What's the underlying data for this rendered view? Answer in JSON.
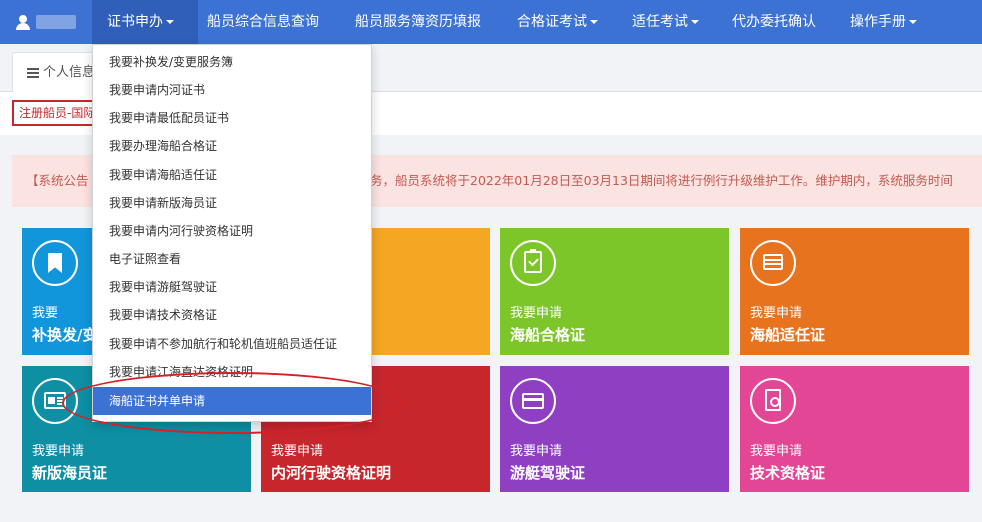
{
  "navbar": {
    "items": [
      {
        "label": "证书申办",
        "caret": true
      },
      {
        "label": "船员综合信息查询",
        "caret": false
      },
      {
        "label": "船员服务簿资历填报",
        "caret": false
      },
      {
        "label": "合格证考试",
        "caret": true
      },
      {
        "label": "适任考试",
        "caret": true
      },
      {
        "label": "代办委托确认",
        "caret": false
      },
      {
        "label": "操作手册",
        "caret": true
      }
    ]
  },
  "tab": {
    "label": "个人信息"
  },
  "status_box": {
    "text": "注册船员-国际"
  },
  "announcement": {
    "left": "【系统公告",
    "right": "务，船员系统将于2022年01月28日至03月13日期间将进行例行升级维护工作。维护期内，系统服务时间"
  },
  "dropdown": {
    "items": [
      "我要补换发/变更服务簿",
      "我要申请内河证书",
      "我要申请最低配员证书",
      "我要办理海船合格证",
      "我要申请海船适任证",
      "我要申请新版海员证",
      "我要申请内河行驶资格证明",
      "电子证照查看",
      "我要申请游艇驾驶证",
      "我要申请技术资格证",
      "我要申请不参加航行和轮机值班船员适任证",
      "我要申请江海直达资格证明",
      "海船证书并单申请"
    ],
    "selected_index": 12
  },
  "tiles": {
    "t1": {
      "line1": "我要",
      "line2": "补换发/变",
      "color": "#1296db",
      "icon": "bookmark-icon"
    },
    "t2": {
      "color": "#f5a623"
    },
    "t3": {
      "line1": "我要申请",
      "line2": "海船合格证",
      "color": "#7cc629",
      "icon": "clipboard-check-icon"
    },
    "t4": {
      "line1": "我要申请",
      "line2": "海船适任证",
      "color": "#e8731f",
      "icon": "list-icon"
    },
    "t5": {
      "line1": "我要申请",
      "line2": "新版海员证",
      "color": "#0e8fa3",
      "icon": "newspaper-icon"
    },
    "t6": {
      "line1": "我要申请",
      "line2": "内河行驶资格证明",
      "color": "#c7262d"
    },
    "t7": {
      "line1": "我要申请",
      "line2": "游艇驾驶证",
      "color": "#8e3fc2",
      "icon": "card-icon"
    },
    "t8": {
      "line1": "我要申请",
      "line2": "技术资格证",
      "color": "#e24695",
      "icon": "document-icon"
    }
  }
}
